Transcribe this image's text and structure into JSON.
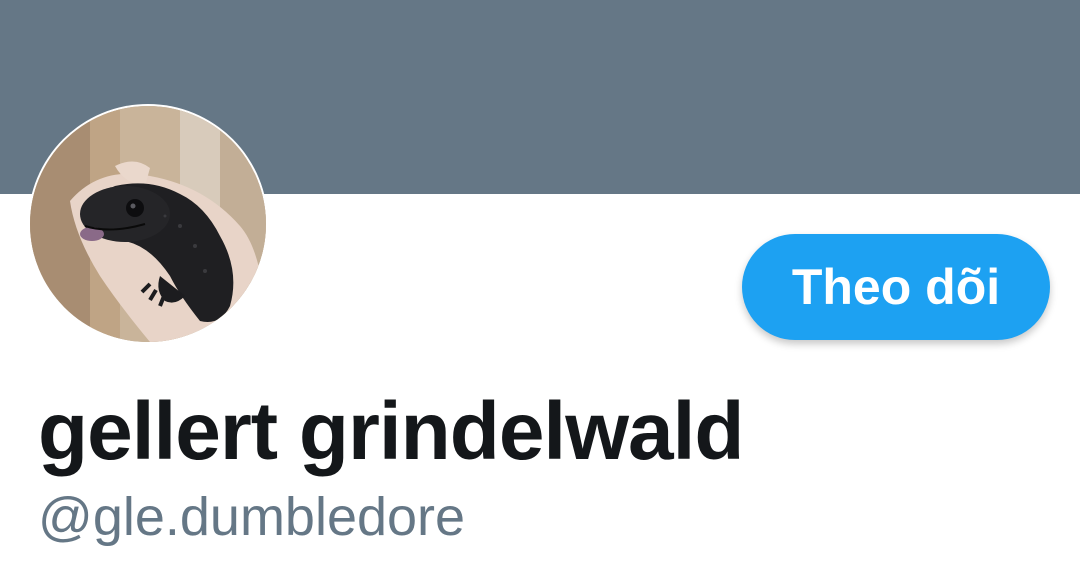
{
  "profile": {
    "display_name": "gellert grindelwald",
    "handle": "@gle.dumbledore",
    "avatar_icon": "gecko-avatar-photo",
    "banner_color": "#657786"
  },
  "actions": {
    "follow_label": "Theo dõi",
    "follow_color": "#1da1f2"
  }
}
